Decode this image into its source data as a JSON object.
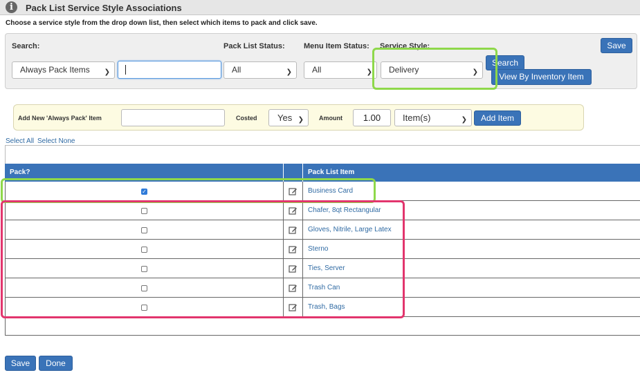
{
  "header": {
    "title": "Pack List Service Style Associations",
    "icon": "info-icon"
  },
  "instructions": "Choose a service style from the drop down list, then select which items to pack and click save.",
  "search": {
    "search_label": "Search:",
    "mode_value": "Always Pack Items",
    "text_value": "",
    "pack_list_status_label": "Pack List Status:",
    "pack_list_status_value": "All",
    "menu_item_status_label": "Menu Item Status:",
    "menu_item_status_value": "All",
    "service_style_label": "Service Style:",
    "service_style_value": "Delivery",
    "search_button": "Search",
    "view_by_inventory_button": "View By Inventory Item",
    "save_button": "Save"
  },
  "add_item": {
    "label": "Add New 'Always Pack' Item",
    "item_value": "",
    "costed_label": "Costed",
    "costed_value": "Yes",
    "amount_label": "Amount",
    "amount_value": "1.00",
    "unit_value": "Item(s)",
    "add_button": "Add Item"
  },
  "select_links": {
    "all": "Select All",
    "none": "Select None"
  },
  "table": {
    "headers": {
      "pack": "Pack?",
      "item": "Pack List Item"
    },
    "rows": [
      {
        "checked": true,
        "item": "Business Card"
      },
      {
        "checked": false,
        "item": "Chafer, 8qt Rectangular"
      },
      {
        "checked": false,
        "item": "Gloves, Nitrile, Large Latex"
      },
      {
        "checked": false,
        "item": "Sterno"
      },
      {
        "checked": false,
        "item": "Ties, Server"
      },
      {
        "checked": false,
        "item": "Trash Can"
      },
      {
        "checked": false,
        "item": "Trash, Bags"
      }
    ]
  },
  "footer": {
    "save_button": "Save",
    "done_button": "Done"
  },
  "colors": {
    "primary": "#3a73b8",
    "highlight_green": "#8ed84a",
    "highlight_pink": "#e2356d",
    "add_panel_bg": "#fdfbe2"
  }
}
